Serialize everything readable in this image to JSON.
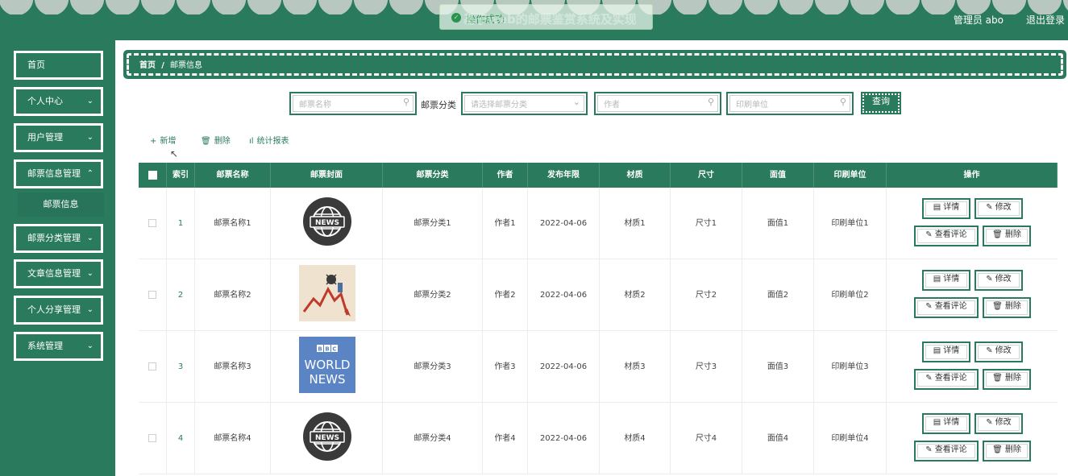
{
  "header": {
    "toast_message": "操作成功",
    "title": "基于web的邮票鉴赏系统及实现",
    "user_label": "管理员 abo",
    "logout_label": "退出登录"
  },
  "sidebar": {
    "items": [
      {
        "label": "首页"
      },
      {
        "label": "个人中心"
      },
      {
        "label": "用户管理"
      },
      {
        "label": "邮票信息管理"
      },
      {
        "label": "邮票分类管理"
      },
      {
        "label": "文章信息管理"
      },
      {
        "label": "个人分享管理"
      },
      {
        "label": "系统管理"
      }
    ],
    "sub_item": "邮票信息"
  },
  "breadcrumb": {
    "home": "首页",
    "sep": "/",
    "current": "邮票信息"
  },
  "search": {
    "name_placeholder": "邮票名称",
    "category_label": "邮票分类",
    "category_placeholder": "请选择邮票分类",
    "author_placeholder": "作者",
    "printer_placeholder": "印刷单位",
    "query_label": "查询"
  },
  "toolbar": {
    "add_label": "新增",
    "delete_label": "删除",
    "stats_label": "统计报表"
  },
  "table": {
    "headers": [
      "索引",
      "邮票名称",
      "邮票封面",
      "邮票分类",
      "作者",
      "发布年限",
      "材质",
      "尺寸",
      "面值",
      "印刷单位",
      "操作"
    ],
    "rows": [
      {
        "index": "1",
        "name": "邮票名称1",
        "cover": "news-globe",
        "category": "邮票分类1",
        "author": "作者1",
        "date": "2022-04-06",
        "material": "材质1",
        "size": "尺寸1",
        "value": "面值1",
        "printer": "印刷单位1"
      },
      {
        "index": "2",
        "name": "邮票名称2",
        "cover": "chart-drop",
        "category": "邮票分类2",
        "author": "作者2",
        "date": "2022-04-06",
        "material": "材质2",
        "size": "尺寸2",
        "value": "面值2",
        "printer": "印刷单位2"
      },
      {
        "index": "3",
        "name": "邮票名称3",
        "cover": "bbc-world-news",
        "category": "邮票分类3",
        "author": "作者3",
        "date": "2022-04-06",
        "material": "材质3",
        "size": "尺寸3",
        "value": "面值3",
        "printer": "印刷单位3"
      },
      {
        "index": "4",
        "name": "邮票名称4",
        "cover": "news-globe",
        "category": "邮票分类4",
        "author": "作者4",
        "date": "2022-04-06",
        "material": "材质4",
        "size": "尺寸4",
        "value": "面值4",
        "printer": "印刷单位4"
      }
    ],
    "actions": {
      "detail": "详情",
      "edit": "修改",
      "comments": "查看评论",
      "delete": "删除"
    }
  },
  "cover_text": {
    "news": "NEWS",
    "bbc": "BBC",
    "world": "WORLD",
    "news_cap": "NEWS"
  },
  "colors": {
    "primary": "#2a7a5d",
    "accent_success": "#2a9c4a"
  }
}
